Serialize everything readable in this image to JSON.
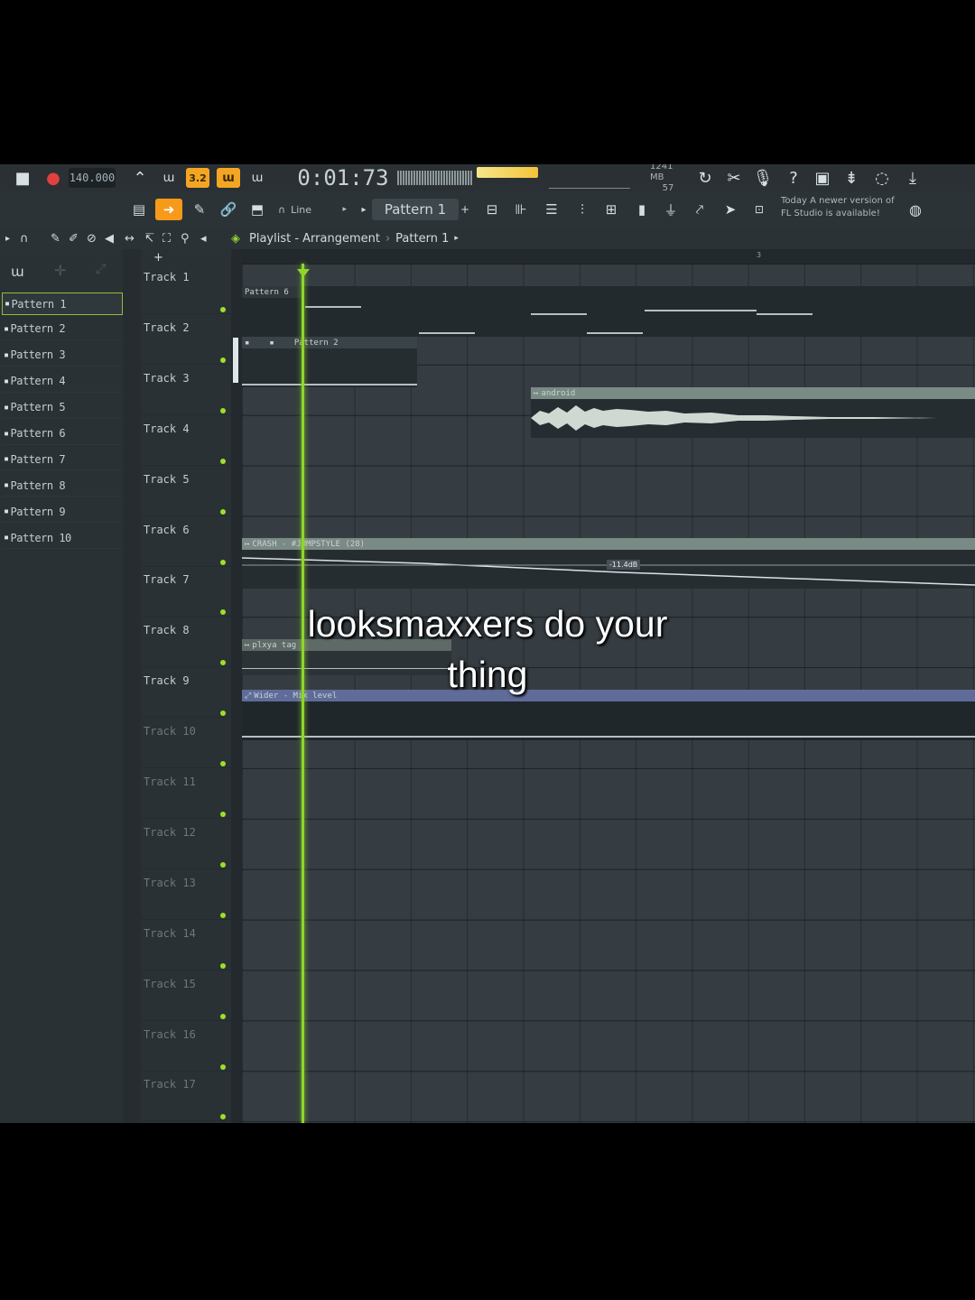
{
  "transport": {
    "tempo": "140.000",
    "pattern_mode_label": "3.2",
    "time": "0:01:73",
    "cpu_mem": "1241 MB",
    "cpu_poly": "57"
  },
  "toolbar2": {
    "snap_label": "Line",
    "pattern_selector": "Pattern 1",
    "notice_line1": "Today  A newer version of",
    "notice_line2": "FL Studio is available!"
  },
  "breadcrumb": {
    "title": "Playlist - Arrangement",
    "sep": "›",
    "pattern": "Pattern 1"
  },
  "patterns": [
    "Pattern 1",
    "Pattern 2",
    "Pattern 3",
    "Pattern 4",
    "Pattern 5",
    "Pattern 6",
    "Pattern 7",
    "Pattern 8",
    "Pattern 9",
    "Pattern 10"
  ],
  "tracks": [
    "Track 1",
    "Track 2",
    "Track 3",
    "Track 4",
    "Track 5",
    "Track 6",
    "Track 7",
    "Track 8",
    "Track 9",
    "Track 10",
    "Track 11",
    "Track 12",
    "Track 13",
    "Track 14",
    "Track 15",
    "Track 16",
    "Track 17"
  ],
  "clips": {
    "pattern6": "Pattern 6",
    "pattern2": "Pattern 2",
    "android": "android",
    "crash": "CRASH - #JUMPSTYLE (28)",
    "crash_value": "-11.4dB",
    "plxya": "plxya tag",
    "wider": "Wider - Mix level"
  },
  "ruler_marker": "3",
  "caption": {
    "line1": "looksmaxxers do your",
    "line2": "thing"
  },
  "colors": {
    "accent": "#f79a1a",
    "playhead": "#8fd62a",
    "audio_clip": "#8a9a92",
    "automation_clip": "#5f6c9a"
  }
}
